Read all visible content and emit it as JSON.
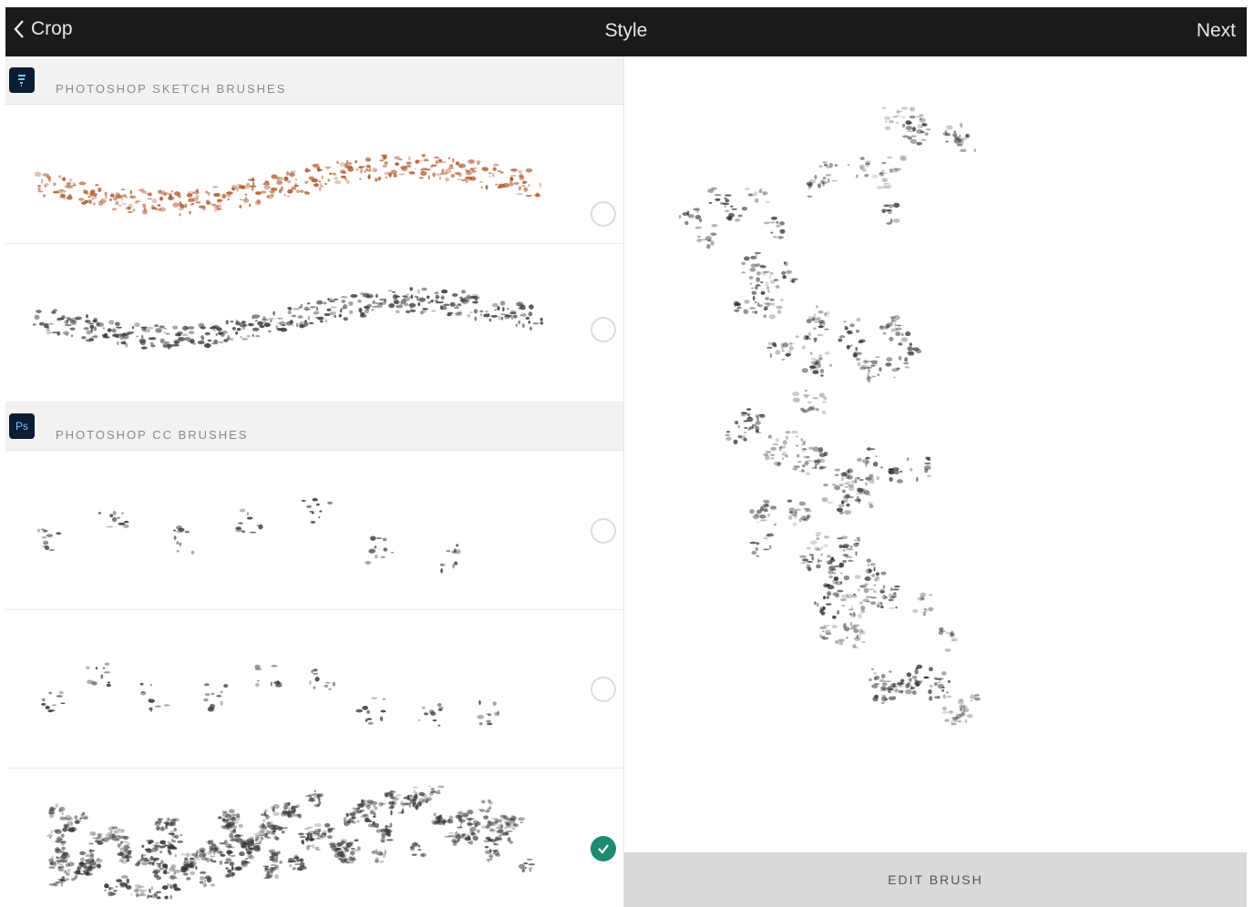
{
  "header": {
    "back_label": "Crop",
    "title": "Style",
    "next_label": "Next"
  },
  "sections": [
    {
      "label": "PHOTOSHOP SKETCH BRUSHES",
      "icon": "sketch-app-icon",
      "icon_text": ""
    },
    {
      "label": "PHOTOSHOP CC BRUSHES",
      "icon": "photoshop-app-icon",
      "icon_text": "Ps"
    }
  ],
  "brushes": [
    {
      "color": "#b0582e",
      "selected": false
    },
    {
      "color": "#3a3a3a",
      "selected": false
    },
    {
      "color": "#333333",
      "selected": false
    },
    {
      "color": "#333333",
      "selected": false
    },
    {
      "color": "#3a3a3a",
      "selected": true
    }
  ],
  "preview": {
    "color": "#2a2a2a"
  },
  "footer": {
    "edit_label": "EDIT BRUSH"
  },
  "colors": {
    "topbar": "#1a1a1a",
    "accent_check": "#1e8a6e",
    "section_bg": "#f2f2f2"
  }
}
